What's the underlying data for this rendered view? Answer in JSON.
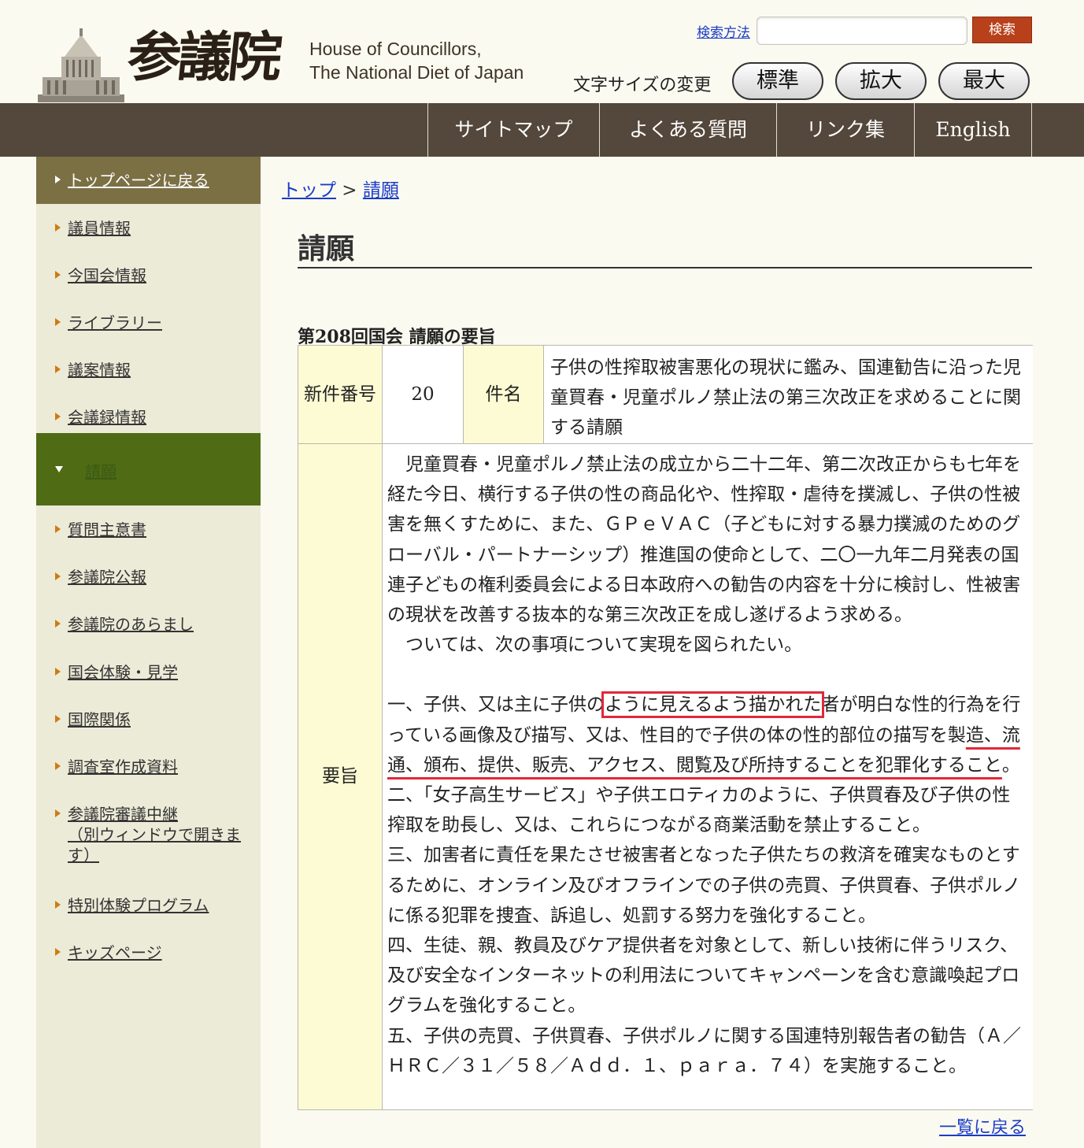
{
  "header": {
    "logo_kanji": "参議院",
    "logo_en_line1": "House of Councillors,",
    "logo_en_line2": "The National Diet of Japan",
    "search_link": "検索方法",
    "search_placeholder": "",
    "search_button": "検索",
    "font_size_label": "文字サイズの変更",
    "font_size_buttons": [
      "標準",
      "拡大",
      "最大"
    ]
  },
  "global_nav": [
    "サイトマップ",
    "よくある質問",
    "リンク集",
    "English"
  ],
  "sidebar": {
    "top_link": "トップページに戻る",
    "items": [
      "議員情報",
      "今国会情報",
      "ライブラリー",
      "議案情報",
      "会議録情報"
    ],
    "active_item": "請願",
    "items_after": [
      "質問主意書",
      "参議院公報",
      "参議院のあらまし",
      "国会体験・見学",
      "国際関係",
      "調査室作成資料"
    ],
    "stream_line1": "参議院審議中継",
    "stream_line2": "（別ウィンドウで開きま",
    "stream_line3": "す）",
    "items_last": [
      "特別体験プログラム",
      "キッズページ"
    ]
  },
  "breadcrumb": {
    "top": "トップ",
    "separator": " > ",
    "current": "請願"
  },
  "page_title": "請願",
  "section_heading": "第208回国会 請願の要旨",
  "petition": {
    "number_label": "新件番号",
    "number_value": "20",
    "subject_label": "件名",
    "subject_value": "子供の性搾取被害悪化の現状に鑑み、国連勧告に沿った児童買春・児童ポルノ禁止法の第三次改正を求めることに関する請願",
    "summary_label": "要旨",
    "para1": "児童買春・児童ポルノ禁止法の成立から二十二年、第二次改正からも七年を経た今日、横行する子供の性の商品化や、性搾取・虐待を撲滅し、子供の性被害を無くすために、また、ＧＰｅＶＡＣ（子どもに対する暴力撲滅のためのグローバル・パートナーシップ）推進国の使命として、二〇一九年二月発表の国連子どもの権利委員会による日本政府への勧告の内容を十分に検討し、性被害の現状を改善する抜本的な第三次改正を成し遂げるよう求める。",
    "para2": "ついては、次の事項について実現を図られたい。",
    "item1_a": "一、子供、又は主に子供の",
    "item1_b": "ように見えるよう描かれた",
    "item1_c": "者が明白な性的行為を行っている画像及び描写、又は、性目的で子供の体の性的部位の描写を製",
    "item1_d": "造、流通、頒布、提供、販売、アクセス、閲覧及び所持することを犯罪化すること",
    "item1_e": "。",
    "item2": "二、「女子高生サービス」や子供エロティカのように、子供買春及び子供の性搾取を助長し、又は、これらにつながる商業活動を禁止すること。",
    "item3": "三、加害者に責任を果たさせ被害者となった子供たちの救済を確実なものとするために、オンライン及びオフラインでの子供の売買、子供買春、子供ポルノに係る犯罪を捜査、訴追し、処罰する努力を強化すること。",
    "item4": "四、生徒、親、教員及びケア提供者を対象として、新しい技術に伴うリスク、及び安全なインターネットの利用法についてキャンペーンを含む意識喚起プログラムを強化すること。",
    "item5": "五、子供の売買、子供買春、子供ポルノに関する国連特別報告者の勧告（Ａ／ＨＲＣ／３１／５８／Ａｄｄ．１、ｐａｒａ．７４）を実施すること。"
  },
  "back_link": "一覧に戻る",
  "colors": {
    "background": "#fbfaf1",
    "nav_bar": "#54473b",
    "sidebar": "#ecebd8",
    "sidebar_top": "#7b6f44",
    "sidebar_active": "#4f6b14",
    "label_cell": "#fdfbd3",
    "search_button": "#b8401a",
    "highlight_annotation": "#e0283a",
    "link": "#1a3cc8"
  }
}
